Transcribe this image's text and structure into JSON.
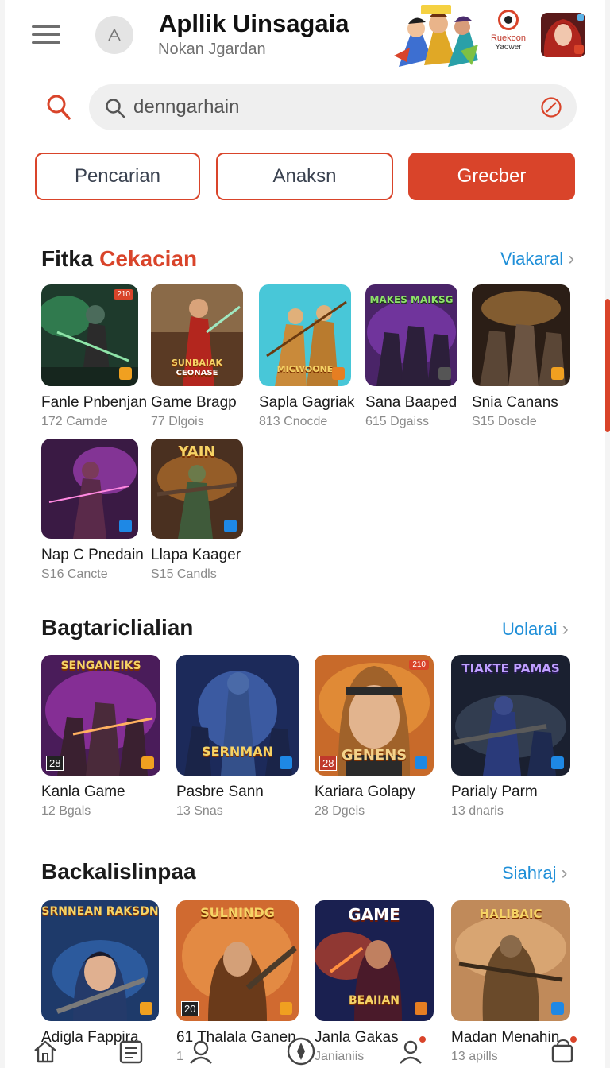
{
  "header": {
    "title": "Apllik Uinsagaia",
    "subtitle": "Nokan Jgardan",
    "promo_logo_line1": "Ruekoon",
    "promo_logo_line2": "Yaower"
  },
  "search": {
    "value": "denngarhain"
  },
  "filters": [
    {
      "label": "Pencarian"
    },
    {
      "label": "Anaksn"
    },
    {
      "label": "Grecber"
    }
  ],
  "sections": {
    "featured": {
      "title_plain": "Fitka",
      "title_accent": "Cekacian",
      "link": "Viakaral",
      "items": [
        {
          "name": "Fanle Pnbenjan",
          "meta": "172 Carnde"
        },
        {
          "name": "Game Bragp",
          "meta": "77 Dlgois"
        },
        {
          "name": "Sapla Gagriak",
          "meta": "813 Cnocde"
        },
        {
          "name": "Sana Baaped",
          "meta": "615 Dgaiss"
        },
        {
          "name": "Snia Canans",
          "meta": "S15 Doscle"
        },
        {
          "name": "Nap C Pnedain",
          "meta": "S16 Cancte"
        },
        {
          "name": "Llapa Kaager",
          "meta": "S15 Candls"
        }
      ]
    },
    "second": {
      "title": "Bagtariclialian",
      "link": "Uolarai",
      "items": [
        {
          "name": "Kanla Game",
          "meta": "12 Bgals"
        },
        {
          "name": "Pasbre Sann",
          "meta": "13 Snas"
        },
        {
          "name": "Kariara Golapy",
          "meta": "28 Dgeis"
        },
        {
          "name": "Parialy Parm",
          "meta": "13 dnaris"
        }
      ]
    },
    "third": {
      "title": "Backalislinpaa",
      "link": "Siahraj",
      "items": [
        {
          "name": "Adigla Fappira",
          "meta": ""
        },
        {
          "name": "61 Thalala Ganen",
          "meta": "1"
        },
        {
          "name": "Janla Gakas",
          "meta": "Janianiis"
        },
        {
          "name": "Madan Menahin",
          "meta": "13 apills"
        }
      ]
    }
  },
  "art_text": {
    "f1": "210",
    "f2": "SUNBAIAK",
    "f2b": "CEONASE",
    "f3": "MICWOONE",
    "f4": "MAKES MAIKSG",
    "f7": "YAIN",
    "s1": "SENGANEIKS",
    "s1n": "28",
    "s2": "SERNMAN",
    "s3": "GENENS",
    "s3n": "28",
    "s3t": "210",
    "s4": "TIAKTE PAMAS",
    "t1": "SRNNEAN RAKSDN",
    "t2": "SULNINDG",
    "t2n": "20",
    "t3": "GAME",
    "t3b": "BEAIIAN",
    "t4": "HALIBAIC"
  },
  "colors": {
    "accent": "#d9442a",
    "link": "#1f8fd8"
  }
}
